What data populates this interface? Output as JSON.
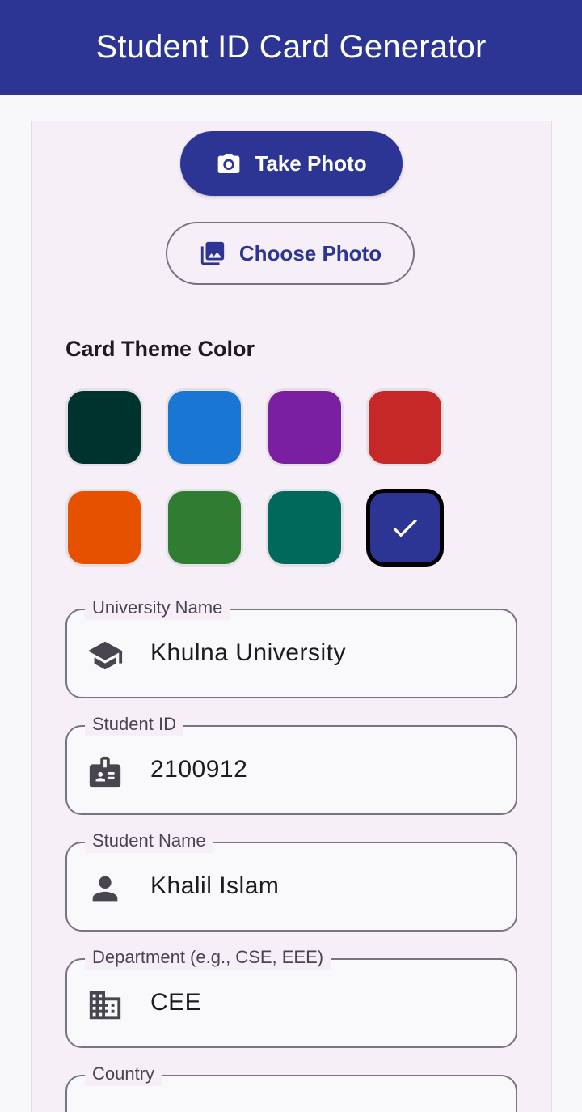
{
  "app": {
    "title": "Student ID Card Generator",
    "accent": "#2c3594"
  },
  "photo": {
    "take_label": "Take Photo",
    "take_icon": "camera-icon",
    "choose_label": "Choose Photo",
    "choose_icon": "photo-library-icon"
  },
  "theme": {
    "section_title": "Card Theme Color",
    "colors": [
      "#00332d",
      "#1976d2",
      "#7b1fa2",
      "#c62828",
      "#e65100",
      "#2e7d32",
      "#00695c",
      "#2c3594"
    ],
    "selected_color": "#2c3594",
    "selected_icon": "check-icon"
  },
  "fields": {
    "university": {
      "label": "University Name",
      "value": "Khulna University",
      "icon": "school-icon"
    },
    "student_id": {
      "label": "Student ID",
      "value": "2100912",
      "icon": "badge-icon"
    },
    "student_name": {
      "label": "Student Name",
      "value": "Khalil Islam",
      "icon": "person-icon"
    },
    "department": {
      "label": "Department (e.g., CSE, EEE)",
      "value": "CEE",
      "icon": "building-icon"
    },
    "country": {
      "label": "Country",
      "value": ""
    }
  }
}
